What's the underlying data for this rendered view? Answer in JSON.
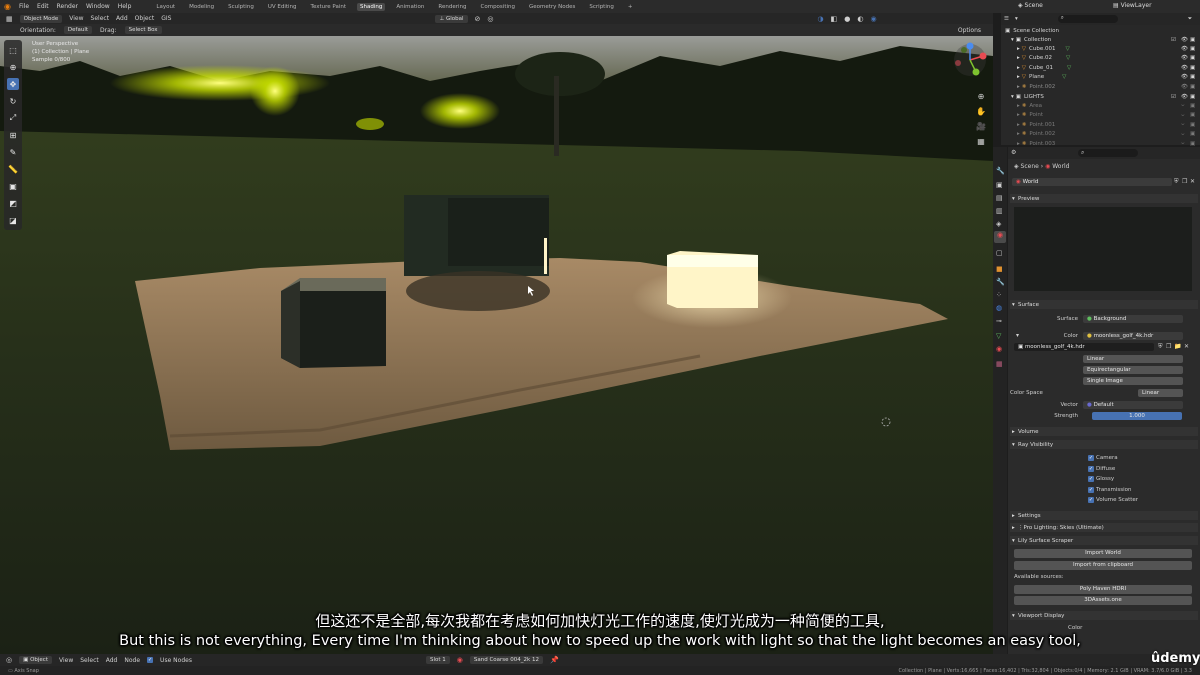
{
  "menu": [
    "File",
    "Edit",
    "Render",
    "Window",
    "Help"
  ],
  "workspaces": [
    "Layout",
    "Modeling",
    "Sculpting",
    "UV Editing",
    "Texture Paint",
    "Shading",
    "Animation",
    "Rendering",
    "Compositing",
    "Geometry Nodes",
    "Scripting",
    "+"
  ],
  "active_workspace": "Shading",
  "top_right": {
    "scene": "Scene",
    "view_layer": "ViewLayer"
  },
  "viewport_header": {
    "mode": "Object Mode",
    "menus": [
      "View",
      "Select",
      "Add",
      "Object",
      "GIS"
    ],
    "orientation": "Global"
  },
  "viewport_tool": {
    "orientation_label": "Orientation:",
    "orientation_value": "Default",
    "drag_label": "Drag:",
    "drag_value": "Select Box",
    "options": "Options"
  },
  "viewport_info": {
    "line1": "User Perspective",
    "line2": "(1) Collection | Plane",
    "line3": "Sample 0/800"
  },
  "outliner": {
    "title": "Scene Collection",
    "collection": "Collection",
    "items": [
      "Cube.001",
      "Cube.02",
      "Cube_01",
      "Plane",
      "Point.002"
    ],
    "lights_collection": "LIGHTS",
    "lights": [
      "Area",
      "Point",
      "Point.001",
      "Point.002",
      "Point.003"
    ]
  },
  "properties": {
    "breadcrumb_scene": "Scene",
    "breadcrumb_world": "World",
    "world_name": "World",
    "preview": "Preview",
    "surface_section": "Surface",
    "surface_label": "Surface",
    "surface_value": "Background",
    "color_label": "Color",
    "color_value": "moonless_golf_4k.hdr",
    "image_name": "moonless_golf_4k.hdr",
    "interp": "Linear",
    "projection": "Equirectangular",
    "source": "Single Image",
    "color_space_label": "Color Space",
    "color_space": "Linear",
    "vector_label": "Vector",
    "vector_value": "Default",
    "strength_label": "Strength",
    "strength_value": "1.000",
    "volume_section": "Volume",
    "ray_visibility_section": "Ray Visibility",
    "ray_items": [
      "Camera",
      "Diffuse",
      "Glossy",
      "Transmission",
      "Volume Scatter"
    ],
    "settings_section": "Settings",
    "pro_lighting_section": "Pro Lighting: Skies (Ultimate)",
    "lily_section": "Lily Surface Scraper",
    "import_world": "Import World",
    "import_clipboard": "Import from clipboard",
    "available_sources": "Available sources:",
    "source_1": "Poly Haven HDRI",
    "source_2": "3DAssets.one",
    "viewport_display_section": "Viewport Display",
    "partial_label": "Color"
  },
  "bottom_bar": {
    "mode": "Object",
    "menus": [
      "View",
      "Select",
      "Add",
      "Node"
    ],
    "use_nodes": "Use Nodes",
    "slot": "Slot 1",
    "material": "Sand Coarse 004_2k",
    "users": "12"
  },
  "status": {
    "left": "Axis Snap",
    "right": "Collection | Plane | Verts:16,665 | Faces:16,402 | Tris:32,804 | Objects:0/4 | Memory: 2.1 GiB | VRAM: 3.7/6.0 GiB | 3.3"
  },
  "subtitles": {
    "chinese": "但这还不是全部,每次我都在考虑如何加快灯光工作的速度,使灯光成为一种简便的工具,",
    "english": "But this is not everything, Every time I'm thinking about how to speed up the work with light so that the light becomes an easy tool,"
  },
  "watermark": "ûdemy",
  "colors": {
    "accent": "#4772b3",
    "outliner_green": "#5fbf5f",
    "mesh_orange": "#e0912f"
  }
}
